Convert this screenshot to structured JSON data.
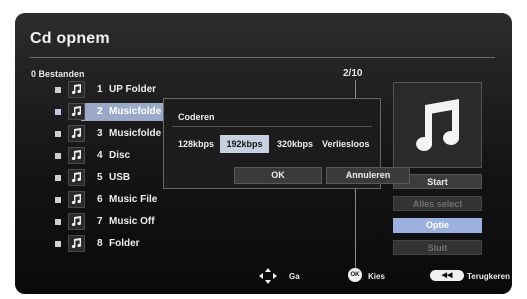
{
  "title": "Cd opnem",
  "file_count": "0 Bestanden",
  "page_indicator": "2/10",
  "list": [
    {
      "number": "1",
      "name": "UP Folder",
      "selected": false
    },
    {
      "number": "2",
      "name": "Musicfolde",
      "selected": true
    },
    {
      "number": "3",
      "name": "Musicfolde",
      "selected": false
    },
    {
      "number": "4",
      "name": "Disc",
      "selected": false
    },
    {
      "number": "5",
      "name": "USB",
      "selected": false
    },
    {
      "number": "6",
      "name": "Music File",
      "selected": false
    },
    {
      "number": "7",
      "name": "Music Off",
      "selected": false
    },
    {
      "number": "8",
      "name": "Folder",
      "selected": false
    }
  ],
  "side_buttons": {
    "start": "Start",
    "select_all": "Alles select",
    "option": "Optie",
    "close": "Sluit"
  },
  "dialog": {
    "title": "Coderen",
    "options": [
      "128kbps",
      "192kbps",
      "320kbps",
      "Verliesloos"
    ],
    "selected_option": "192kbps",
    "ok": "OK",
    "cancel": "Annuleren"
  },
  "hints": {
    "navigate": "Ga",
    "ok_badge": "OK",
    "select": "Kies",
    "back": "Terugkeren"
  },
  "icons": {
    "file": "music-note-icon",
    "thumbnail": "music-note-icon",
    "navigate": "dpad-arrows-icon",
    "back": "rewind-icon"
  },
  "colors": {
    "highlight": "#9aa9c8",
    "option_button": "#9bb0df",
    "selected_option": "#c7cfe0"
  }
}
